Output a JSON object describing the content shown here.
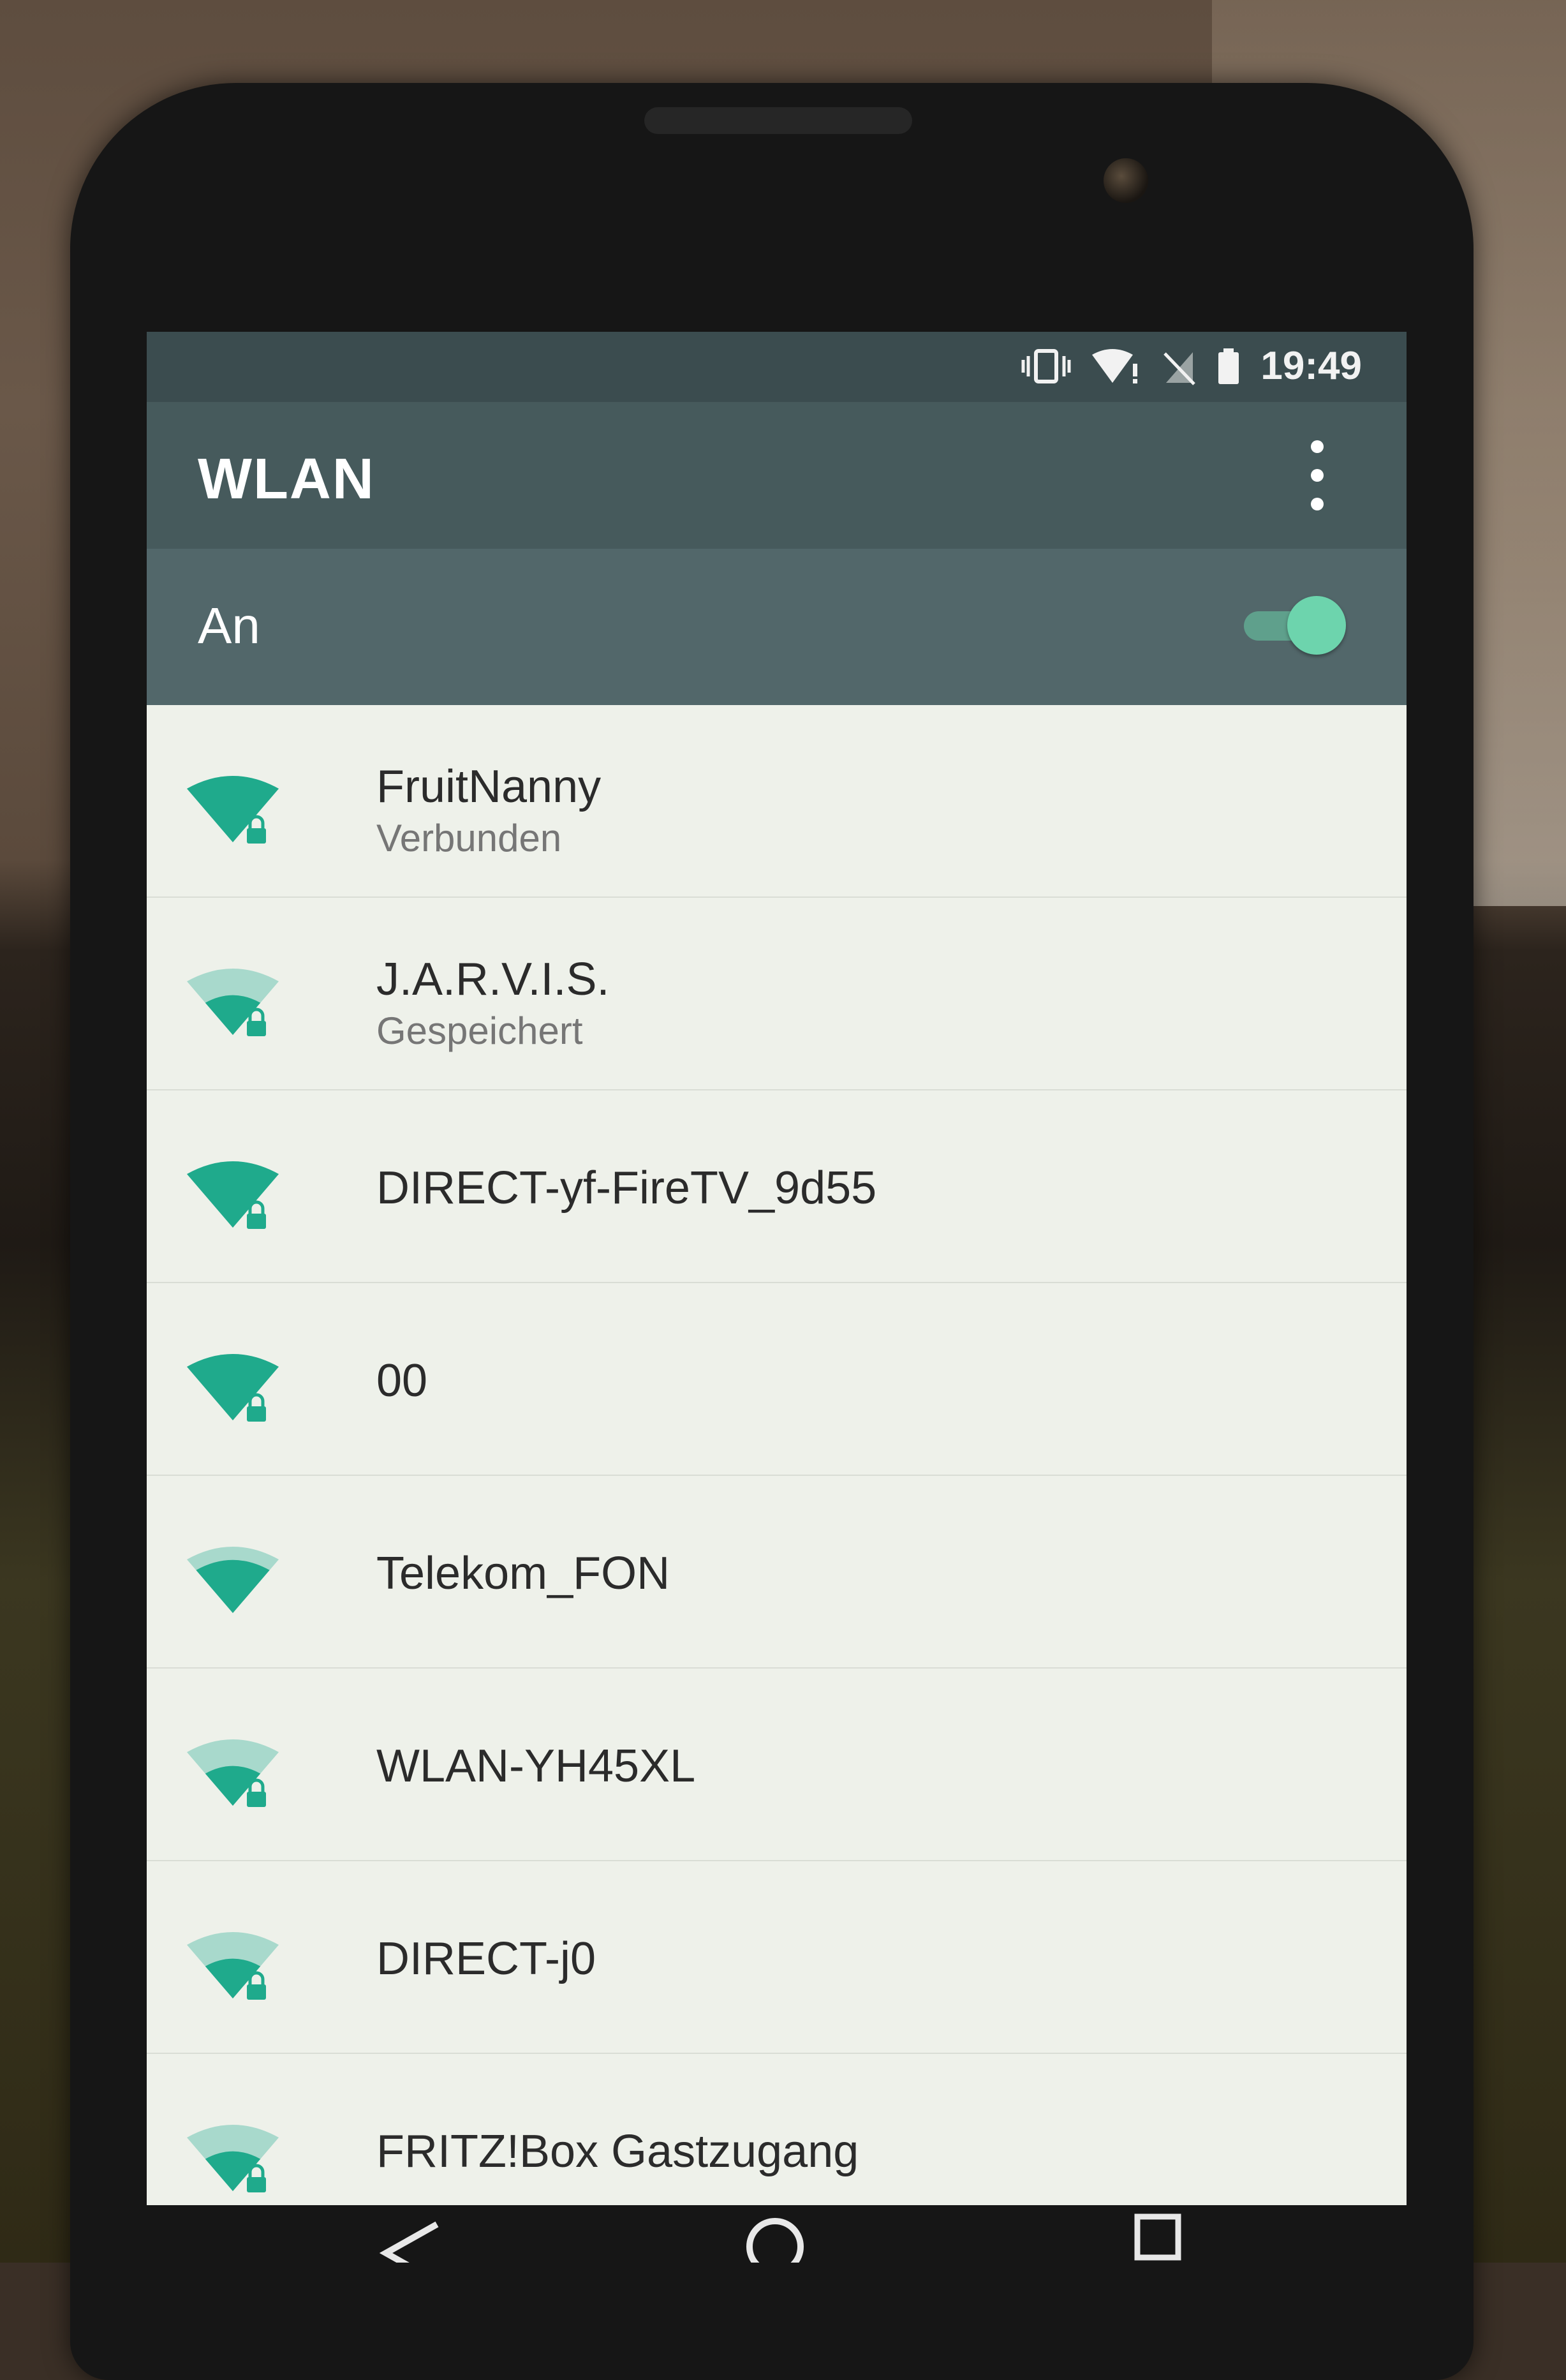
{
  "status_bar": {
    "time": "19:49",
    "icons": [
      "vibrate-icon",
      "wifi-alert-icon",
      "no-sim-icon",
      "battery-icon"
    ]
  },
  "toolbar": {
    "title": "WLAN",
    "menu_icon": "overflow-menu-icon"
  },
  "wifi_switch": {
    "label": "An",
    "state": "on"
  },
  "networks": [
    {
      "name": "FruitNanny",
      "status": "Verbunden",
      "signal": 4,
      "locked": true
    },
    {
      "name": "J.A.R.V.I.S.",
      "status": "Gespeichert",
      "signal": 2,
      "locked": true
    },
    {
      "name": "DIRECT-yf-FireTV_9d55",
      "status": "",
      "signal": 4,
      "locked": true
    },
    {
      "name": "00",
      "status": "",
      "signal": 4,
      "locked": true
    },
    {
      "name": "Telekom_FON",
      "status": "",
      "signal": 3,
      "locked": false
    },
    {
      "name": "WLAN-YH45XL",
      "status": "",
      "signal": 2,
      "locked": true
    },
    {
      "name": "DIRECT-j0",
      "status": "",
      "signal": 2,
      "locked": true
    },
    {
      "name": "FRITZ!Box Gastzugang",
      "status": "",
      "signal": 2,
      "locked": true
    }
  ],
  "navigation": {
    "icons": [
      "back-icon",
      "home-icon",
      "recents-icon"
    ]
  },
  "colors": {
    "status_bar": "#3b4c4f",
    "toolbar": "#465a5c",
    "switch_bar": "#52676a",
    "accent": "#1faa8c",
    "list_background": "#eef1ea"
  }
}
